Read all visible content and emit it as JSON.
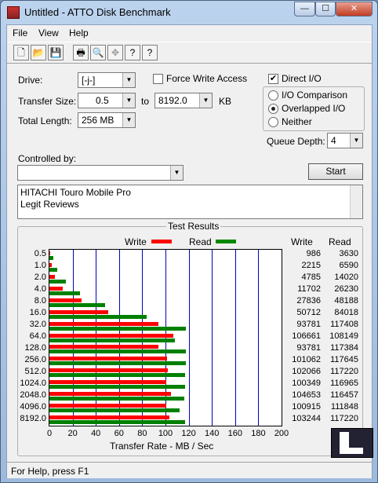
{
  "window": {
    "title": "Untitled - ATTO Disk Benchmark",
    "minimize": "—",
    "maximize": "☐",
    "close": "✕"
  },
  "menu": [
    "File",
    "View",
    "Help"
  ],
  "toolbar": [
    {
      "icon": "new-icon",
      "g": "🗋"
    },
    {
      "icon": "open-icon",
      "g": "📂"
    },
    {
      "icon": "save-icon",
      "g": "💾"
    },
    {
      "icon": "print-icon",
      "g": "🖶"
    },
    {
      "icon": "print-preview-icon",
      "g": "🔍"
    },
    {
      "icon": "move-icon",
      "g": "✥"
    },
    {
      "icon": "help-icon",
      "g": "?"
    },
    {
      "icon": "context-help-icon",
      "g": "?"
    }
  ],
  "settings": {
    "drive_label": "Drive:",
    "drive_value": "[-j-]",
    "transfer_label": "Transfer Size:",
    "transfer_from": "0.5",
    "to_label": "to",
    "transfer_to": "8192.0",
    "unit": "KB",
    "total_label": "Total Length:",
    "total_value": "256 MB",
    "force_write": "Force Write Access",
    "force_write_checked": false,
    "direct_io": "Direct I/O",
    "direct_io_checked": true,
    "io_options": [
      "I/O Comparison",
      "Overlapped I/O",
      "Neither"
    ],
    "io_selected": 1,
    "queue_label": "Queue Depth:",
    "queue_value": "4",
    "controlled_label": "Controlled by:",
    "controlled_value": "",
    "start_label": "Start"
  },
  "description": [
    "HITACHI Touro Mobile Pro",
    "Legit Reviews"
  ],
  "results": {
    "title": "Test Results",
    "write_legend": "Write",
    "read_legend": "Read",
    "write_col": "Write",
    "read_col": "Read",
    "x_label": "Transfer Rate - MB / Sec",
    "write_color": "#ff0000",
    "read_color": "#008000",
    "grid_color": "#0000c0"
  },
  "chart_data": {
    "type": "bar",
    "categories": [
      "0.5",
      "1.0",
      "2.0",
      "4.0",
      "8.0",
      "16.0",
      "32.0",
      "64.0",
      "128.0",
      "256.0",
      "512.0",
      "1024.0",
      "2048.0",
      "4096.0",
      "8192.0"
    ],
    "series": [
      {
        "name": "Write",
        "values": [
          986,
          2215,
          4785,
          11702,
          27836,
          50712,
          93781,
          106661,
          93781,
          101062,
          102066,
          100349,
          104653,
          100915,
          103244
        ]
      },
      {
        "name": "Read",
        "values": [
          3630,
          6590,
          14020,
          26230,
          48188,
          84018,
          117408,
          108149,
          117384,
          117645,
          117220,
          116965,
          116457,
          111848,
          117220
        ]
      }
    ],
    "bar_scale_divisor": 1000,
    "xticks": [
      0,
      20,
      40,
      60,
      80,
      100,
      120,
      140,
      160,
      180,
      200
    ],
    "xlim": [
      0,
      200
    ],
    "xlabel": "Transfer Rate - MB / Sec"
  },
  "status": "For Help, press F1"
}
